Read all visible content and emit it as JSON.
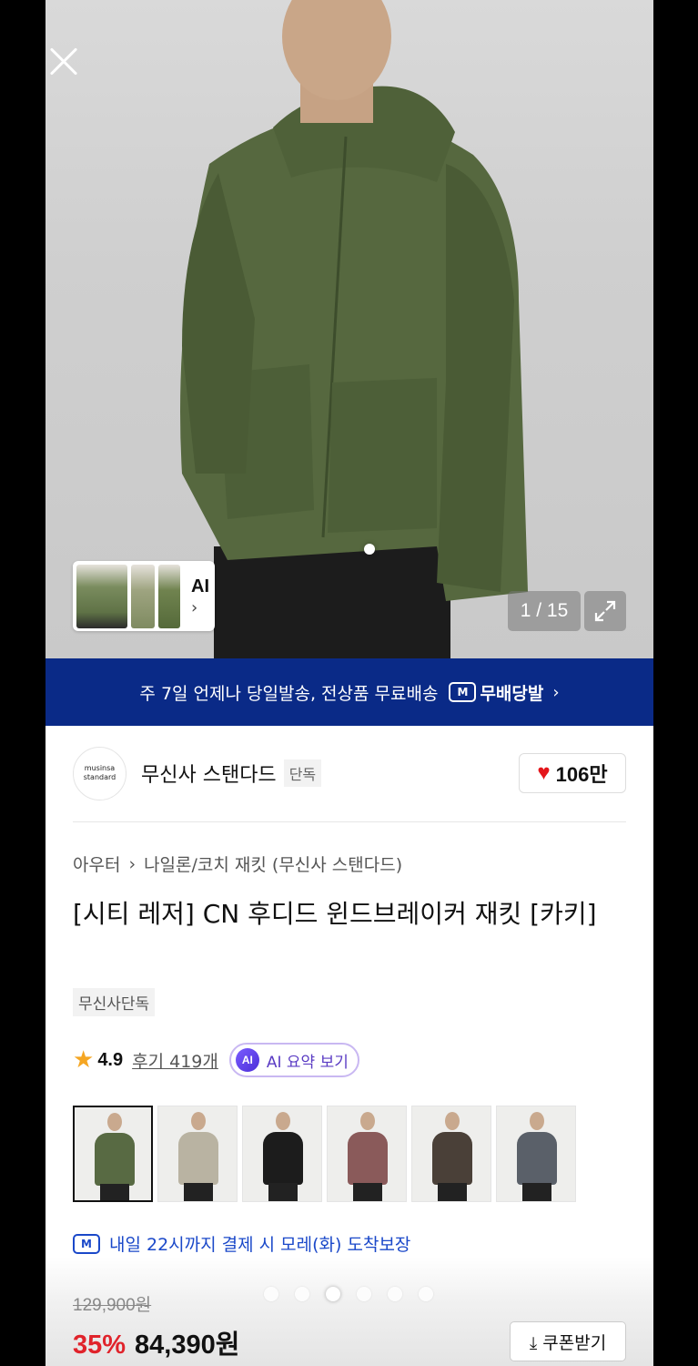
{
  "gallery": {
    "counter": "1 / 15",
    "ai_label": "AI",
    "ai_chevron": "›"
  },
  "banner": {
    "text": "주 7일 언제나 당일발송, 전상품 무료배송",
    "badge": "M",
    "brand": "무배당발",
    "chevron": "›"
  },
  "brand": {
    "logo_line1": "musinsa",
    "logo_line2": "standard",
    "name": "무신사 스탠다드",
    "exclusive_tag": "단독",
    "likes": "106만"
  },
  "breadcrumb": {
    "category": "아우터",
    "separator": "›",
    "subcategory": "나일론/코치 재킷 (무신사 스탠다드)"
  },
  "product": {
    "title": "[시티 레저] CN 후디드 윈드브레이커 재킷 [카키]",
    "tag": "무신사단독",
    "rating": "4.9",
    "reviews": "후기 419개",
    "ai_summary_icon": "AI",
    "ai_summary": "AI 요약 보기",
    "delivery_badge": "M",
    "delivery": "내일 22시까지 결제 시 모레(화) 도착보장",
    "original_price": "129,900원",
    "discount": "35%",
    "price": "84,390원",
    "coupon_button": "⤓ 쿠폰받기"
  },
  "variants": [
    {
      "color": "#586a43",
      "selected": true
    },
    {
      "color": "#b9b3a2",
      "selected": false
    },
    {
      "color": "#1c1c1c",
      "selected": false
    },
    {
      "color": "#8a5a5a",
      "selected": false
    },
    {
      "color": "#4a4038",
      "selected": false
    },
    {
      "color": "#5a6069",
      "selected": false
    }
  ],
  "colors": {
    "banner_bg": "#0a2a87",
    "discount": "#e0232b",
    "delivery_blue": "#1a48c9",
    "heart": "#e4161b",
    "star": "#f5a623"
  },
  "pager": {
    "count": 6,
    "active_index": 2
  }
}
